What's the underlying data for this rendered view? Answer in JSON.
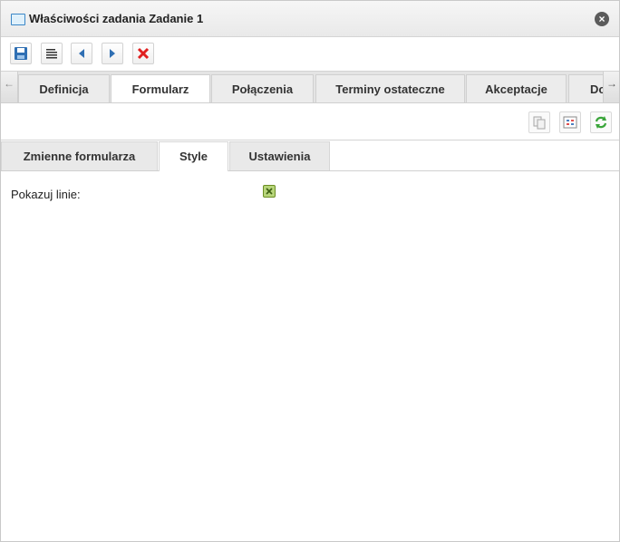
{
  "window": {
    "title": "Właściwości zadania Zadanie 1"
  },
  "toolbar": {
    "buttons": [
      {
        "name": "save",
        "icon": "floppy-disk-icon"
      },
      {
        "name": "spellcheck",
        "icon": "text-lines-icon"
      },
      {
        "name": "previous",
        "icon": "arrow-left-icon"
      },
      {
        "name": "next",
        "icon": "arrow-right-icon"
      },
      {
        "name": "delete",
        "icon": "red-x-icon"
      }
    ]
  },
  "tabs": {
    "items": [
      {
        "label": "Definicja"
      },
      {
        "label": "Formularz",
        "active": true
      },
      {
        "label": "Połączenia"
      },
      {
        "label": "Terminy ostateczne"
      },
      {
        "label": "Akceptacje"
      },
      {
        "label": "Do"
      }
    ]
  },
  "actions": {
    "buttons": [
      {
        "name": "copy",
        "icon": "copy-icon"
      },
      {
        "name": "grid",
        "icon": "grid-icon"
      },
      {
        "name": "refresh",
        "icon": "refresh-icon"
      }
    ]
  },
  "subtabs": {
    "items": [
      {
        "label": "Zmienne formularza"
      },
      {
        "label": "Style",
        "active": true
      },
      {
        "label": "Ustawienia"
      }
    ]
  },
  "form": {
    "show_lines_label": "Pokazuj linie:",
    "show_lines_checked": true
  },
  "colors": {
    "accent": "#3a86c7",
    "delete": "#e02020",
    "checkbox": "#b7d57a",
    "refresh": "#3aa53a"
  }
}
